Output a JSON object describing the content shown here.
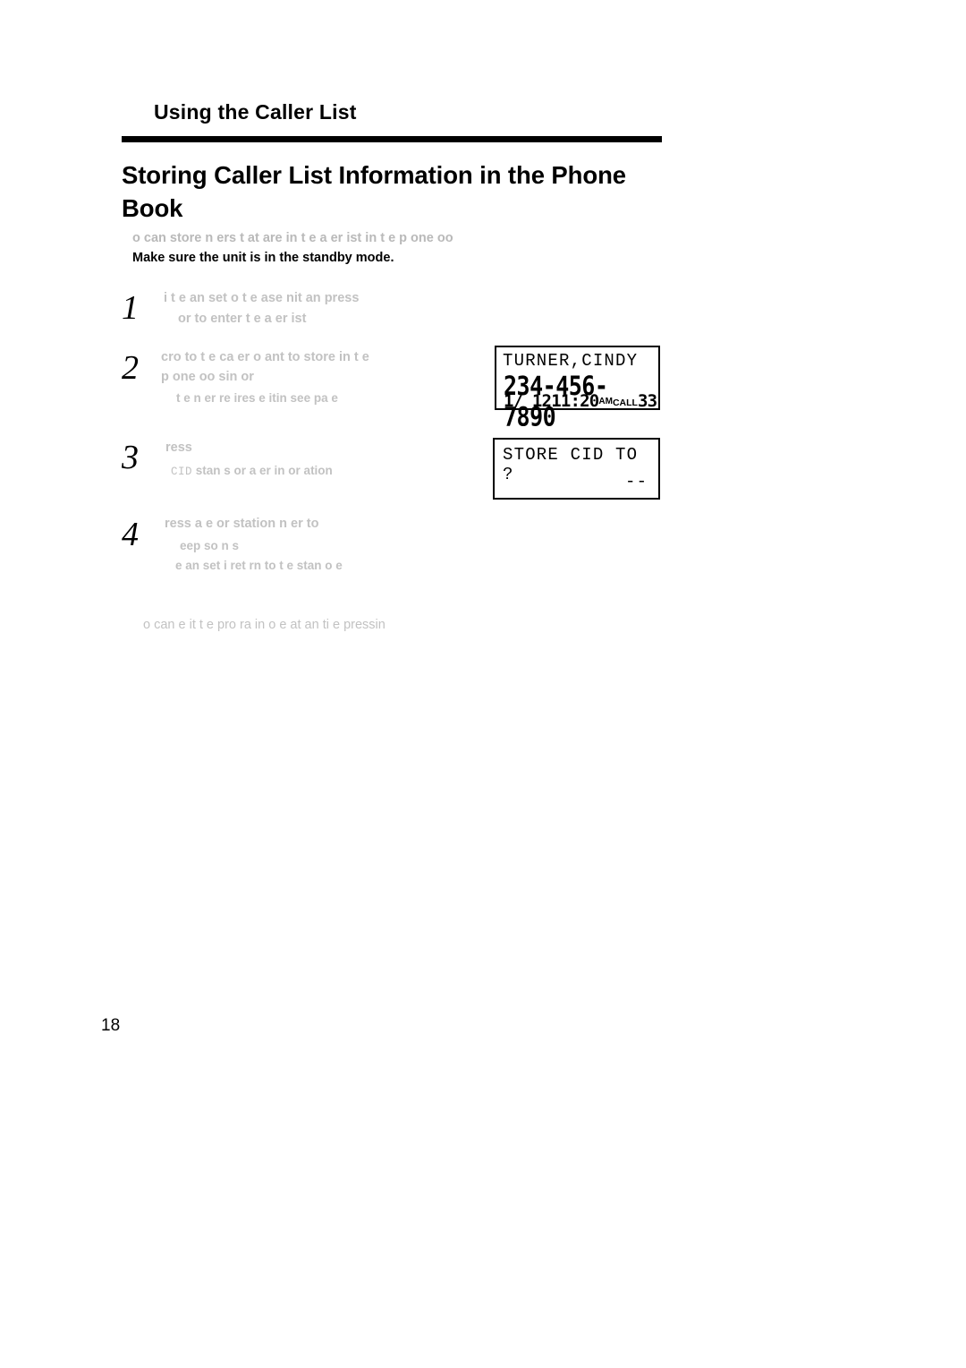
{
  "header": {
    "running_head": "Using the Caller List",
    "title": "Storing Caller List Information in the Phone Book"
  },
  "intro": {
    "line1": "o  can store n    ers t at are in t e   a er   ist in t e p one   oo",
    "line2": "Make sure the unit is in the standby mode."
  },
  "steps": [
    {
      "number": "1",
      "line1": "i  t  e   an  set o   t e   ase   nit  an   press",
      "line2": "or    to enter t e   a er   ist"
    },
    {
      "number": "2",
      "line1": "cro   to t e ca  er  o    ant to store in t e",
      "line2": "p  one   oo      sin      or",
      "line3": "t e n      er re   ires e itin    see pa  e"
    },
    {
      "number": "3",
      "line1": "ress",
      "sub_mono": "CID",
      "sub_rest": " stan  s  or   a  er    in or  ation"
    },
    {
      "number": "4",
      "line1": "ress a    e  or    station n      er  to",
      "line2": "eep so  n  s",
      "line3": "e   an  set   i   ret  rn to t e stan       o  e"
    }
  ],
  "lcd_caller": {
    "name": "TURNER,CINDY",
    "number": "234-456-7890",
    "date": "1/ 12",
    "time": "11:20",
    "meridiem": "AM",
    "call_label": "CALL",
    "call_count": "33"
  },
  "lcd_store": {
    "line1": "STORE CID TO ?",
    "line2": "--"
  },
  "footnote": {
    "text": "o  can e it t e pro  ra   in    o  e at an   ti  e    pressin"
  },
  "page_number": "18"
}
